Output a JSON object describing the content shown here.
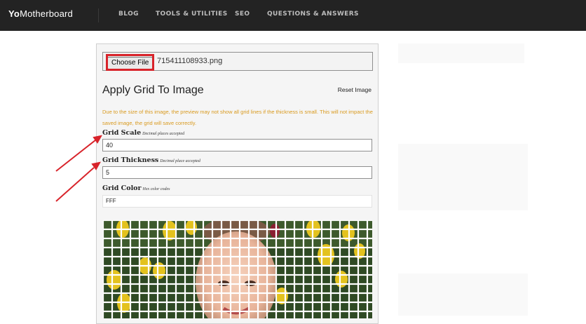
{
  "header": {
    "logo_bold": "Yo",
    "logo_rest": "Motherboard",
    "nav": [
      "BLOG",
      "TOOLS & UTILITIES",
      "SEO",
      "QUESTIONS & ANSWERS"
    ]
  },
  "file_picker": {
    "button_label": "Choose File",
    "file_name": "715411108933.png"
  },
  "tool": {
    "title": "Apply Grid To Image",
    "reset_label": "Reset Image",
    "warning": "Due to the size of this image, the preview may not show all grid lines if the thickness is small. This will not impact the saved image, the grid will save correctly."
  },
  "fields": {
    "grid_scale": {
      "label": "Grid Scale",
      "hint": "Decimal places accepted",
      "value": "40"
    },
    "grid_thickness": {
      "label": "Grid Thickness",
      "hint": "Decimal place accepted",
      "value": "5"
    },
    "grid_color": {
      "label": "Grid Color",
      "hint": "Hex color codes",
      "value": "FFF"
    }
  },
  "colors": {
    "nav_bg": "#232323",
    "highlight_red": "#d8232a",
    "warning_text": "#d99a1f",
    "grid_line": "#ffffff"
  }
}
